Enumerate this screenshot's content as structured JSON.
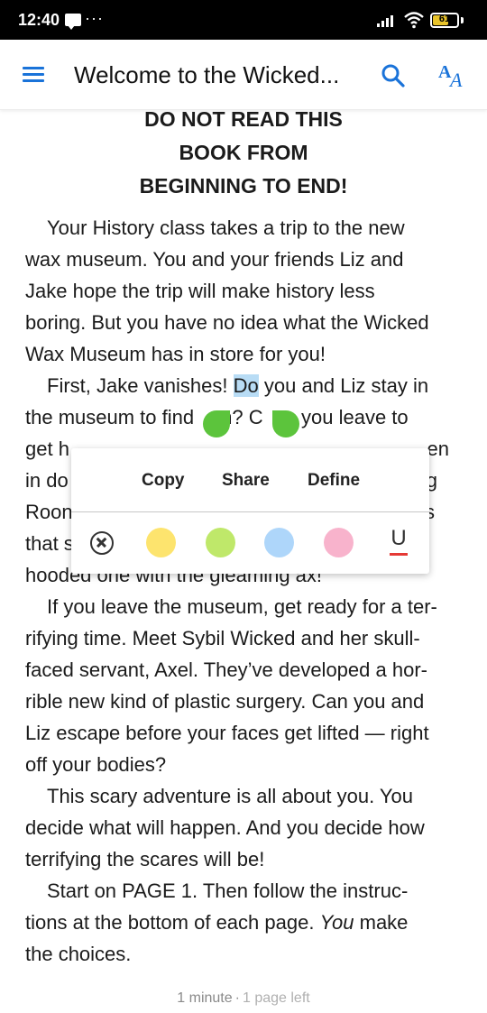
{
  "status_bar": {
    "time": "12:40",
    "overflow": "···",
    "battery": "61",
    "battery_color": "#e8c32a"
  },
  "app_bar": {
    "menu_icon": "hamburger-menu-icon",
    "title": "Welcome to the Wicked...",
    "search_icon": "search-icon",
    "font_icon": "font-size-icon",
    "accent": "#1a73d9"
  },
  "content": {
    "heading": [
      "DO NOT READ THIS",
      "BOOK FROM",
      "BEGINNING TO END!"
    ],
    "lines": {
      "l1": "Your History class takes a trip to the new",
      "l2": "wax museum. You and your friends Liz and",
      "l3": "Jake hope the trip will make history less",
      "l4": "boring. But you have no idea what the Wicked",
      "l5": "Wax Museum has in store for you!",
      "l6_a": "First, Jake vanishes! ",
      "l6_sel": "Do",
      "l6_b": " you and Liz stay in",
      "l7_a": "the museum to find",
      "l7_b": "m? C",
      "l7_c": "o you leave to",
      "l8_a": "get h",
      "l8_b": "en",
      "l9_a": "in do",
      "l9_b": "g",
      "l10_a": "Roon",
      "l10_b": "s",
      "l11_a": "that s",
      "l12": "hooded one with the gleaming ax!",
      "l13": "If you leave the museum, get ready for a ter-",
      "l14": "rifying time. Meet Sybil Wicked and her skull-",
      "l15": "faced servant, Axel. They’ve developed a hor-",
      "l16": "rible new kind of plastic surgery. Can you and",
      "l17": "Liz escape before your faces get lifted — right",
      "l18": "off your bodies?",
      "l19": "This scary adventure is all about you. You",
      "l20": "decide what will happen. And you decide how",
      "l21": "terrifying the scares will be!",
      "l22": "Start on PAGE 1. Then follow the instruc-",
      "l23_a": "tions at the bottom of each page. ",
      "l23_em": "You",
      "l23_b": " make",
      "l24": "the choices."
    },
    "selection_color": "#b8dcf5"
  },
  "popup": {
    "copy": "Copy",
    "share": "Share",
    "define": "Define",
    "underline_label": "U",
    "colors": {
      "yellow": "#fde46e",
      "green": "#bfe86a",
      "blue": "#aed6fa",
      "pink": "#f8b3cc"
    },
    "handle_color": "#5cc43c"
  },
  "footer": {
    "time_left": "1 minute",
    "separator": "·",
    "pages_left": "1 page left"
  }
}
